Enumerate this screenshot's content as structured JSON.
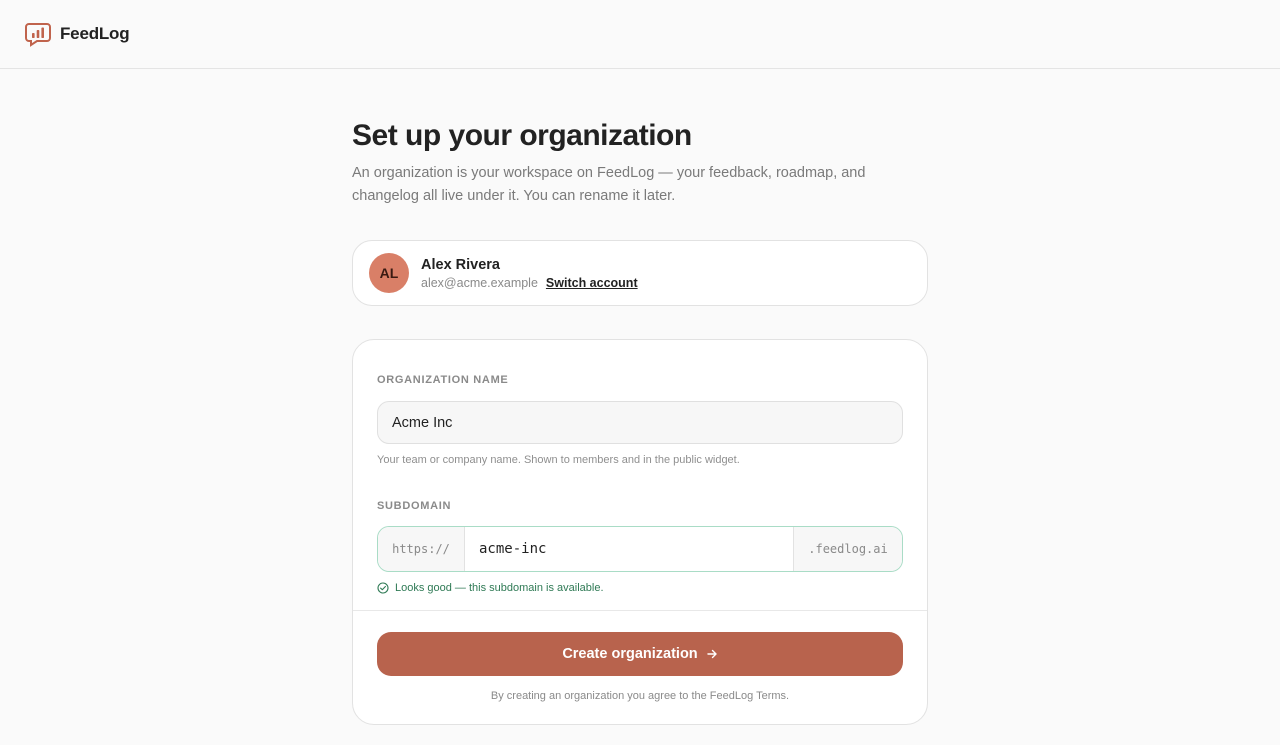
{
  "app": {
    "name": "FeedLog",
    "brand_color": "#b8634d"
  },
  "page": {
    "title": "Set up your organization",
    "subtitle": "An organization is your workspace on FeedLog — your feedback, roadmap, and changelog all live under it. You can rename it later."
  },
  "account": {
    "initials": "AL",
    "name": "Alex Rivera",
    "email": "alex@acme.example",
    "switch_label": "Switch account"
  },
  "form": {
    "org_name": {
      "label": "ORGANIZATION NAME",
      "value": "Acme Inc",
      "hint": "Your team or company name. Shown to members and in the public widget."
    },
    "subdomain": {
      "label": "SUBDOMAIN",
      "prefix": "https://",
      "value": "acme-inc",
      "suffix": ".feedlog.ai",
      "status": "Looks good — this subdomain is available.",
      "status_color": "#2f7a55"
    },
    "submit_label": "Create organization",
    "terms": "By creating an organization you agree to the FeedLog Terms."
  }
}
